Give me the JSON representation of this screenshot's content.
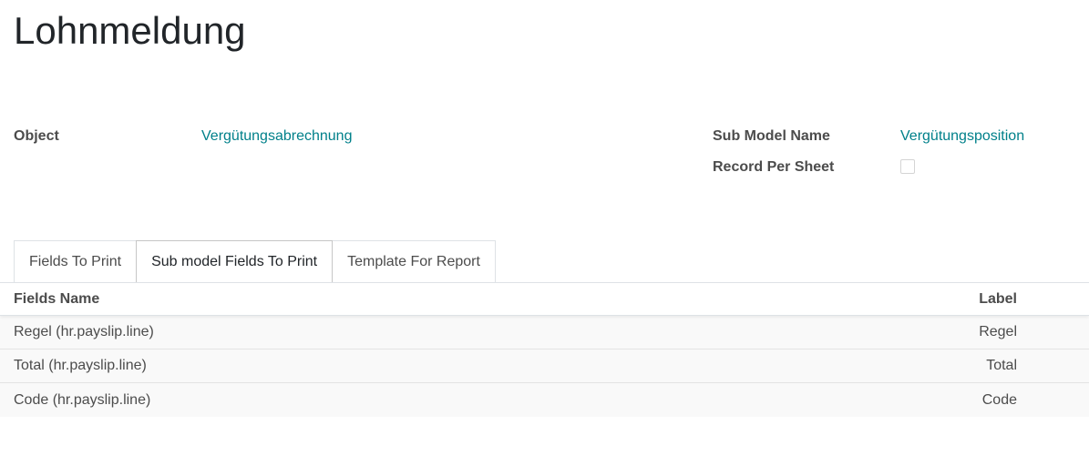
{
  "form": {
    "title": "Lohnmeldung",
    "object_label": "Object",
    "object_value": "Vergütungsabrechnung",
    "sub_model_label": "Sub Model Name",
    "sub_model_value": "Vergütungsposition",
    "record_per_sheet_label": "Record Per Sheet",
    "record_per_sheet_checked": false
  },
  "tabs": [
    {
      "label": "Fields To Print",
      "active": false
    },
    {
      "label": "Sub model Fields To Print",
      "active": true
    },
    {
      "label": "Template For Report",
      "active": false
    }
  ],
  "table": {
    "columns": [
      "Fields Name",
      "Label"
    ],
    "rows": [
      {
        "field": "Regel (hr.payslip.line)",
        "label": "Regel"
      },
      {
        "field": "Total (hr.payslip.line)",
        "label": "Total"
      },
      {
        "field": "Code (hr.payslip.line)",
        "label": "Code"
      }
    ]
  },
  "colors": {
    "link": "#00808a",
    "label_text": "#4c4c4c",
    "row_background": "#f9f9f9"
  }
}
